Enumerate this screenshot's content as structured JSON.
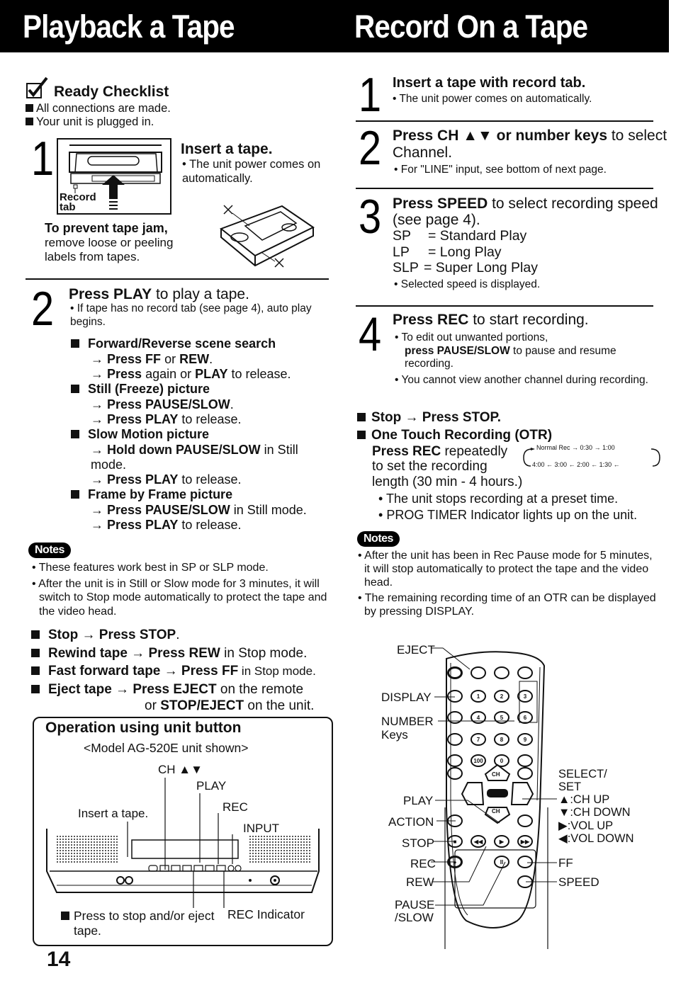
{
  "header": {
    "left_title": "Playback a Tape",
    "right_title": "Record On a Tape"
  },
  "checklist": {
    "title": "Ready Checklist",
    "items": [
      "All connections are made.",
      "Your unit is plugged in."
    ]
  },
  "playback": {
    "step1": {
      "number": "1",
      "title": "Insert a tape.",
      "bullet": "The unit power comes on automatically.",
      "record_tab_label": "Record tab",
      "jam_title": "To prevent tape jam,",
      "jam_text": "remove loose or peeling labels from tapes."
    },
    "step2": {
      "number": "2",
      "title_bold": "Press PLAY",
      "title_rest": " to play a tape.",
      "bullet": "If tape has no record tab (see page 4), auto play begins.",
      "features": [
        {
          "title": "Forward/Reverse scene search",
          "lines": [
            {
              "bold": "Press FF",
              "rest": " or ",
              "bold2": "REW",
              "rest2": "."
            },
            {
              "bold": "Press",
              "rest": " again or ",
              "bold2": "PLAY",
              "rest2": " to release."
            }
          ]
        },
        {
          "title": "Still (Freeze) picture",
          "lines": [
            {
              "bold": "Press PAUSE/SLOW",
              "rest": ".",
              "bold2": "",
              "rest2": ""
            },
            {
              "bold": "Press PLAY",
              "rest": " to release.",
              "bold2": "",
              "rest2": ""
            }
          ]
        },
        {
          "title": "Slow Motion picture",
          "lines": [
            {
              "bold": "Hold down PAUSE/SLOW",
              "rest": " in Still mode.",
              "bold2": "",
              "rest2": ""
            },
            {
              "bold": "Press PLAY",
              "rest": " to release.",
              "bold2": "",
              "rest2": ""
            }
          ]
        },
        {
          "title": "Frame by Frame picture",
          "lines": [
            {
              "bold": "Press PAUSE/SLOW",
              "rest": " in Still mode.",
              "bold2": "",
              "rest2": ""
            },
            {
              "bold": "Press PLAY",
              "rest": " to release.",
              "bold2": "",
              "rest2": ""
            }
          ]
        }
      ]
    },
    "notes_label": "Notes",
    "notes": [
      "These features work best in SP or SLP mode.",
      "After the unit is in Still or Slow mode for 3 minutes, it will switch to Stop mode automatically to protect the tape and the video head."
    ],
    "actions": [
      {
        "bold": "Stop → Press STOP",
        "rest": "."
      },
      {
        "bold": "Rewind tape → Press REW",
        "rest": " in Stop mode."
      },
      {
        "bold": "Fast forward tape → Press FF",
        "rest": " in Stop mode."
      },
      {
        "bold": "Eject tape →  Press EJECT",
        "rest": " on the remote"
      }
    ],
    "eject_line2_pre": "or ",
    "eject_line2_bold": "STOP/EJECT",
    "eject_line2_rest": " on the unit."
  },
  "operation": {
    "title": "Operation using unit button",
    "subtitle": "<Model AG-520E unit shown>",
    "labels": {
      "ch": "CH ▲▼",
      "play": "PLAY",
      "rec": "REC",
      "input": "INPUT",
      "insert": "Insert a tape.",
      "stop_eject": "Press to stop and/or eject tape.",
      "rec_indicator": "REC Indicator"
    }
  },
  "page_number": "14",
  "record": {
    "step1": {
      "number": "1",
      "title": "Insert a tape with record tab.",
      "bullet": "The unit power comes on automatically."
    },
    "step2": {
      "number": "2",
      "title_bold": "Press CH ▲▼ or number keys",
      "title_rest": " to select Channel.",
      "bullet": "For \"LINE\" input, see bottom of next page."
    },
    "step3": {
      "number": "3",
      "title_bold": "Press SPEED",
      "title_rest": " to select recording speed (see page 4).",
      "speeds": [
        {
          "code": "SP",
          "name": "= Standard Play"
        },
        {
          "code": "LP",
          "name": "= Long Play"
        },
        {
          "code": "SLP",
          "name": "= Super Long Play"
        }
      ],
      "bullet": "Selected speed is displayed."
    },
    "step4": {
      "number": "4",
      "title_bold": "Press REC",
      "title_rest": " to start recording.",
      "bullet1_pre": "To edit out unwanted portions,",
      "bullet1_bold": "press PAUSE/SLOW",
      "bullet1_rest": " to pause and resume recording.",
      "bullet2": "You cannot view another channel during recording."
    },
    "stop": "Stop → Press STOP.",
    "otr": {
      "title": "One Touch Recording (OTR)",
      "line1_bold": "Press REC",
      "line1_rest": " repeatedly",
      "line2": "to set the recording",
      "line3": "length (30 min - 4 hours.)",
      "cycle_top": [
        "Normal Rec",
        "0:30",
        "1:00"
      ],
      "cycle_bottom": [
        "4:00",
        "3:00",
        "2:00",
        "1:30"
      ],
      "bullets": [
        "The unit stops recording at a preset time.",
        "PROG TIMER Indicator lights up on the unit."
      ]
    },
    "notes_label": "Notes",
    "notes": [
      "After the unit has been in Rec Pause mode for 5 minutes, it will stop automatically to protect the tape and the video head.",
      "The remaining recording time of an OTR can be displayed by pressing DISPLAY."
    ]
  },
  "remote": {
    "left_labels": {
      "eject": "EJECT",
      "display": "DISPLAY",
      "number": "NUMBER",
      "keys": "Keys",
      "play": "PLAY",
      "action": "ACTION",
      "stop": "STOP",
      "rec": "REC",
      "rew": "REW",
      "pause": "PAUSE",
      "slow": "/SLOW"
    },
    "right_labels": {
      "select": "SELECT/",
      "set": "SET",
      "ch_up": "▲:CH UP",
      "ch_down": "▼:CH DOWN",
      "vol_up": "▶:VOL UP",
      "vol_down": "◀:VOL DOWN",
      "ff": "FF",
      "speed": "SPEED"
    },
    "keys": [
      "1",
      "2",
      "3",
      "4",
      "5",
      "6",
      "7",
      "8",
      "9",
      "100",
      "0"
    ],
    "ch_label": "CH"
  }
}
